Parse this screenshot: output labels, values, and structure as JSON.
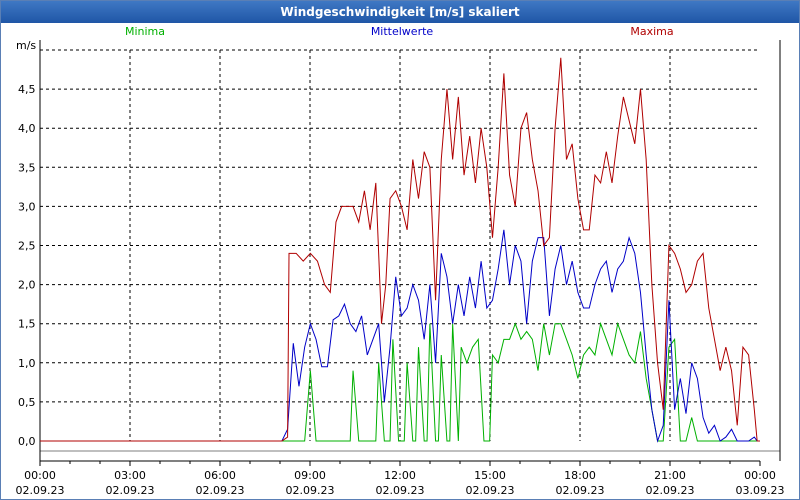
{
  "window": {
    "title": "Windgeschwindigkeit [m/s] skaliert"
  },
  "chart_data": {
    "type": "line",
    "unit_label": "m/s",
    "ylim": [
      0,
      5
    ],
    "y_ticks": [
      "0,0",
      "0,5",
      "1,0",
      "1,5",
      "2,0",
      "2,5",
      "3,0",
      "3,5",
      "4,0",
      "4,5"
    ],
    "x_ticks": [
      {
        "time": "00:00",
        "date": "02.09.23"
      },
      {
        "time": "03:00",
        "date": "02.09.23"
      },
      {
        "time": "06:00",
        "date": "02.09.23"
      },
      {
        "time": "09:00",
        "date": "02.09.23"
      },
      {
        "time": "12:00",
        "date": "02.09.23"
      },
      {
        "time": "15:00",
        "date": "02.09.23"
      },
      {
        "time": "18:00",
        "date": "02.09.23"
      },
      {
        "time": "21:00",
        "date": "02.09.23"
      },
      {
        "time": "00:00",
        "date": "03.09.23"
      }
    ],
    "grid": true,
    "colors": {
      "Minima": "#00b000",
      "Mittelwerte": "#0000c8",
      "Maxima": "#b00000"
    },
    "series": [
      {
        "name": "Maxima",
        "color": "#b00000",
        "points": [
          [
            0,
            0
          ],
          [
            8.5,
            0
          ],
          [
            8.7,
            0.05
          ],
          [
            8.75,
            2.4
          ],
          [
            9,
            2.4
          ],
          [
            9.25,
            2.3
          ],
          [
            9.5,
            2.4
          ],
          [
            9.75,
            2.3
          ],
          [
            10,
            2.0
          ],
          [
            10.2,
            1.9
          ],
          [
            10.4,
            2.8
          ],
          [
            10.6,
            3.0
          ],
          [
            11,
            3.0
          ],
          [
            11.2,
            2.8
          ],
          [
            11.4,
            3.2
          ],
          [
            11.6,
            2.7
          ],
          [
            11.8,
            3.3
          ],
          [
            12,
            1.5
          ],
          [
            12.15,
            2.0
          ],
          [
            12.3,
            3.1
          ],
          [
            12.5,
            3.2
          ],
          [
            12.7,
            3.0
          ],
          [
            12.9,
            2.7
          ],
          [
            13.1,
            3.6
          ],
          [
            13.3,
            3.1
          ],
          [
            13.5,
            3.7
          ],
          [
            13.7,
            3.5
          ],
          [
            13.9,
            1.8
          ],
          [
            14.1,
            3.6
          ],
          [
            14.3,
            4.5
          ],
          [
            14.5,
            3.6
          ],
          [
            14.7,
            4.4
          ],
          [
            14.9,
            3.4
          ],
          [
            15.1,
            3.9
          ],
          [
            15.3,
            3.3
          ],
          [
            15.5,
            4.0
          ],
          [
            15.7,
            3.5
          ],
          [
            15.9,
            2.6
          ],
          [
            16.1,
            3.5
          ],
          [
            16.3,
            4.7
          ],
          [
            16.5,
            3.4
          ],
          [
            16.7,
            3.0
          ],
          [
            16.9,
            4.0
          ],
          [
            17.1,
            4.2
          ],
          [
            17.3,
            3.6
          ],
          [
            17.5,
            3.2
          ],
          [
            17.7,
            2.5
          ],
          [
            17.9,
            2.6
          ],
          [
            18.1,
            4.0
          ],
          [
            18.3,
            4.9
          ],
          [
            18.5,
            3.6
          ],
          [
            18.7,
            3.8
          ],
          [
            18.9,
            3.1
          ],
          [
            19.1,
            2.7
          ],
          [
            19.3,
            2.7
          ],
          [
            19.5,
            3.4
          ],
          [
            19.7,
            3.3
          ],
          [
            19.9,
            3.7
          ],
          [
            20.1,
            3.3
          ],
          [
            20.3,
            3.9
          ],
          [
            20.5,
            4.4
          ],
          [
            20.7,
            4.1
          ],
          [
            20.9,
            3.8
          ],
          [
            21.1,
            4.5
          ],
          [
            21.3,
            3.6
          ],
          [
            21.5,
            2.0
          ],
          [
            21.7,
            1.0
          ],
          [
            21.9,
            0.4
          ],
          [
            22.1,
            2.5
          ],
          [
            22.3,
            2.4
          ],
          [
            22.5,
            2.2
          ],
          [
            22.7,
            1.9
          ],
          [
            22.9,
            2.0
          ],
          [
            23.1,
            2.3
          ],
          [
            23.3,
            2.4
          ],
          [
            23.5,
            1.7
          ],
          [
            23.7,
            1.3
          ],
          [
            23.9,
            0.9
          ],
          [
            24.1,
            1.2
          ],
          [
            24.3,
            0.9
          ],
          [
            24.5,
            0.2
          ],
          [
            24.7,
            1.2
          ],
          [
            24.9,
            1.1
          ],
          [
            25.1,
            0.4
          ],
          [
            25.2,
            0
          ],
          [
            25.3,
            0
          ]
        ]
      },
      {
        "name": "Mittelwerte",
        "color": "#0000c8",
        "points": [
          [
            0,
            0
          ],
          [
            8.5,
            0
          ],
          [
            8.7,
            0.15
          ],
          [
            8.9,
            1.25
          ],
          [
            9.1,
            0.7
          ],
          [
            9.3,
            1.2
          ],
          [
            9.5,
            1.5
          ],
          [
            9.7,
            1.3
          ],
          [
            9.9,
            0.95
          ],
          [
            10.1,
            0.95
          ],
          [
            10.3,
            1.55
          ],
          [
            10.5,
            1.6
          ],
          [
            10.7,
            1.75
          ],
          [
            10.9,
            1.5
          ],
          [
            11.1,
            1.4
          ],
          [
            11.3,
            1.6
          ],
          [
            11.5,
            1.1
          ],
          [
            11.7,
            1.3
          ],
          [
            11.9,
            1.5
          ],
          [
            12.1,
            0.5
          ],
          [
            12.3,
            1.2
          ],
          [
            12.5,
            2.1
          ],
          [
            12.7,
            1.6
          ],
          [
            12.9,
            1.7
          ],
          [
            13.1,
            2.0
          ],
          [
            13.3,
            1.8
          ],
          [
            13.5,
            1.3
          ],
          [
            13.7,
            2.0
          ],
          [
            13.9,
            1.0
          ],
          [
            14.1,
            2.4
          ],
          [
            14.3,
            2.1
          ],
          [
            14.5,
            1.5
          ],
          [
            14.7,
            2.0
          ],
          [
            14.9,
            1.6
          ],
          [
            15.1,
            2.1
          ],
          [
            15.3,
            1.7
          ],
          [
            15.5,
            2.3
          ],
          [
            15.7,
            1.7
          ],
          [
            15.9,
            1.8
          ],
          [
            16.1,
            2.2
          ],
          [
            16.3,
            2.7
          ],
          [
            16.5,
            2.0
          ],
          [
            16.7,
            2.5
          ],
          [
            16.9,
            2.3
          ],
          [
            17.1,
            1.5
          ],
          [
            17.3,
            2.3
          ],
          [
            17.5,
            2.6
          ],
          [
            17.7,
            2.6
          ],
          [
            17.9,
            1.6
          ],
          [
            18.1,
            2.2
          ],
          [
            18.3,
            2.5
          ],
          [
            18.5,
            2.0
          ],
          [
            18.7,
            2.3
          ],
          [
            18.9,
            1.9
          ],
          [
            19.1,
            1.7
          ],
          [
            19.3,
            1.7
          ],
          [
            19.5,
            2.0
          ],
          [
            19.7,
            2.2
          ],
          [
            19.9,
            2.3
          ],
          [
            20.1,
            1.9
          ],
          [
            20.3,
            2.2
          ],
          [
            20.5,
            2.3
          ],
          [
            20.7,
            2.6
          ],
          [
            20.9,
            2.4
          ],
          [
            21.1,
            1.9
          ],
          [
            21.3,
            1.1
          ],
          [
            21.5,
            0.4
          ],
          [
            21.7,
            0.0
          ],
          [
            21.9,
            0.2
          ],
          [
            22.1,
            1.8
          ],
          [
            22.3,
            0.4
          ],
          [
            22.5,
            0.8
          ],
          [
            22.7,
            0.35
          ],
          [
            22.9,
            1.0
          ],
          [
            23.1,
            0.8
          ],
          [
            23.3,
            0.3
          ],
          [
            23.5,
            0.1
          ],
          [
            23.7,
            0.2
          ],
          [
            23.9,
            0.0
          ],
          [
            24.1,
            0.05
          ],
          [
            24.3,
            0.15
          ],
          [
            24.5,
            0.0
          ],
          [
            24.7,
            0.0
          ],
          [
            24.9,
            0.0
          ],
          [
            25.1,
            0.05
          ],
          [
            25.2,
            0
          ],
          [
            25.3,
            0
          ]
        ]
      },
      {
        "name": "Minima",
        "color": "#00b000",
        "points": [
          [
            0,
            0
          ],
          [
            9.3,
            0
          ],
          [
            9.5,
            0.9
          ],
          [
            9.7,
            0
          ],
          [
            10.9,
            0
          ],
          [
            11.0,
            0.9
          ],
          [
            11.2,
            0
          ],
          [
            11.8,
            0
          ],
          [
            11.9,
            1.0
          ],
          [
            12.1,
            0
          ],
          [
            12.3,
            0
          ],
          [
            12.4,
            1.3
          ],
          [
            12.6,
            0
          ],
          [
            12.8,
            0
          ],
          [
            12.9,
            1.0
          ],
          [
            13.1,
            0
          ],
          [
            13.2,
            0
          ],
          [
            13.3,
            1.2
          ],
          [
            13.5,
            0
          ],
          [
            13.6,
            0
          ],
          [
            13.7,
            1.5
          ],
          [
            13.9,
            0
          ],
          [
            14.0,
            0
          ],
          [
            14.1,
            1.1
          ],
          [
            14.3,
            0
          ],
          [
            14.4,
            0
          ],
          [
            14.5,
            1.5
          ],
          [
            14.7,
            0
          ],
          [
            14.8,
            1.2
          ],
          [
            15.0,
            1.0
          ],
          [
            15.2,
            1.2
          ],
          [
            15.4,
            1.3
          ],
          [
            15.6,
            0
          ],
          [
            15.8,
            0
          ],
          [
            15.9,
            1.1
          ],
          [
            16.1,
            1.0
          ],
          [
            16.3,
            1.3
          ],
          [
            16.5,
            1.3
          ],
          [
            16.7,
            1.5
          ],
          [
            16.9,
            1.3
          ],
          [
            17.1,
            1.4
          ],
          [
            17.3,
            1.3
          ],
          [
            17.5,
            0.9
          ],
          [
            17.7,
            1.5
          ],
          [
            17.9,
            1.1
          ],
          [
            18.1,
            1.5
          ],
          [
            18.3,
            1.5
          ],
          [
            18.5,
            1.3
          ],
          [
            18.7,
            1.1
          ],
          [
            18.9,
            0.8
          ],
          [
            19.1,
            1.1
          ],
          [
            19.3,
            1.2
          ],
          [
            19.5,
            1.1
          ],
          [
            19.7,
            1.5
          ],
          [
            19.9,
            1.3
          ],
          [
            20.1,
            1.1
          ],
          [
            20.3,
            1.5
          ],
          [
            20.5,
            1.3
          ],
          [
            20.7,
            1.1
          ],
          [
            20.9,
            1.0
          ],
          [
            21.1,
            1.4
          ],
          [
            21.3,
            0.8
          ],
          [
            21.5,
            0.4
          ],
          [
            21.7,
            0.0
          ],
          [
            21.9,
            0.0
          ],
          [
            22.1,
            1.2
          ],
          [
            22.3,
            1.3
          ],
          [
            22.5,
            0.0
          ],
          [
            22.7,
            0
          ],
          [
            22.9,
            0.3
          ],
          [
            23.1,
            0
          ],
          [
            25.3,
            0
          ]
        ]
      }
    ]
  }
}
